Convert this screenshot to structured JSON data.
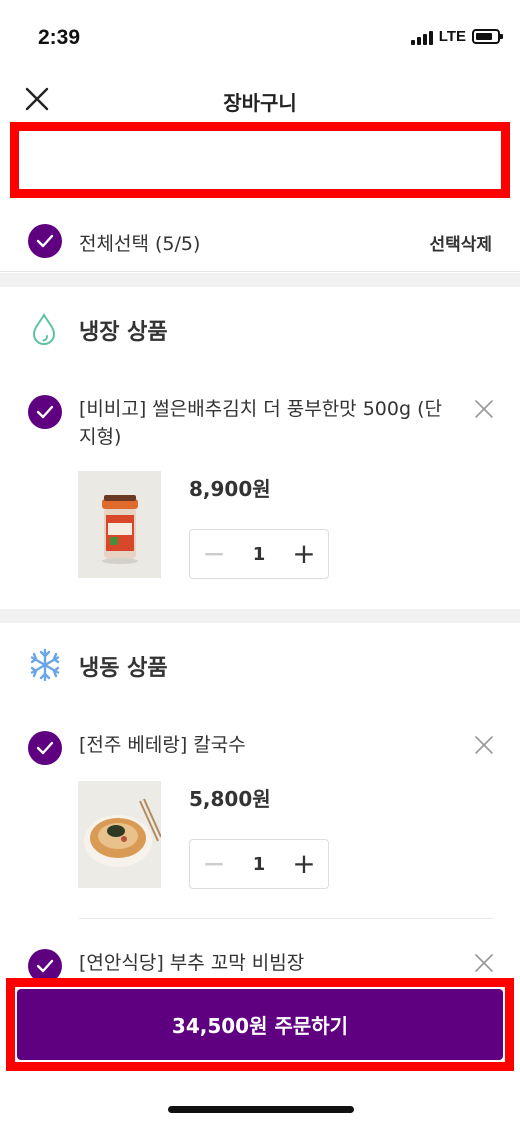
{
  "status_bar": {
    "time": "2:39",
    "network": "LTE"
  },
  "header": {
    "title": "장바구니"
  },
  "select_all": {
    "label": "전체선택 (5/5)",
    "delete_label": "선택삭제"
  },
  "sections": [
    {
      "title": "냉장 상품",
      "icon": "water-drop-icon",
      "items": [
        {
          "name": "[비비고] 썰은배추김치 더 풍부한맛 500g (단지형)",
          "price": "8,900원",
          "quantity": "1"
        }
      ]
    },
    {
      "title": "냉동 상품",
      "icon": "snowflake-icon",
      "items": [
        {
          "name": "[전주 베테랑] 칼국수",
          "price": "5,800원",
          "quantity": "1"
        },
        {
          "name": "[연안식당] 부추 꼬막 비빔장"
        }
      ]
    }
  ],
  "order_button": {
    "label": "34,500원 주문하기"
  },
  "colors": {
    "accent": "#5f0080",
    "highlight_box": "#ff0000",
    "fridge_icon": "#5ec3a6",
    "freezer_icon": "#6aa6e6"
  }
}
